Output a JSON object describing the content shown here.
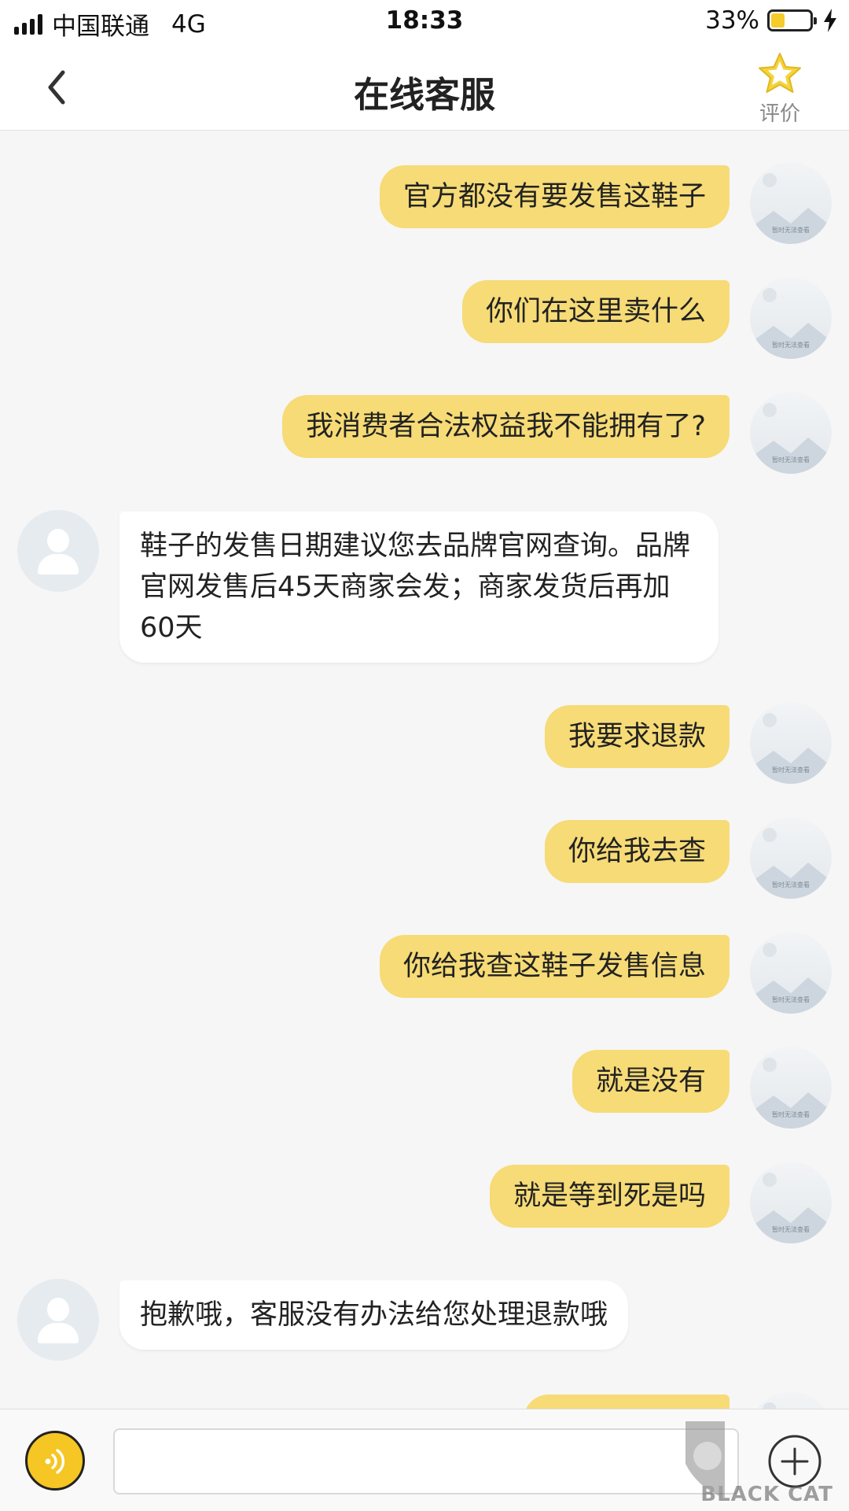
{
  "status_bar": {
    "carrier": "中国联通",
    "network": "4G",
    "time": "18:33",
    "battery_text": "33%",
    "battery_level": 0.33
  },
  "nav": {
    "title": "在线客服",
    "rate_label": "评价"
  },
  "avatar_placeholder_text": "暂时无法查看",
  "messages": [
    {
      "from": "me",
      "text": "官方都没有要发售这鞋子"
    },
    {
      "from": "me",
      "text": "你们在这里卖什么"
    },
    {
      "from": "me",
      "text": "我消费者合法权益我不能拥有了?"
    },
    {
      "from": "agent",
      "text": "鞋子的发售日期建议您去品牌官网查询。品牌官网发售后45天商家会发；商家发货后再加60天"
    },
    {
      "from": "me",
      "text": "我要求退款"
    },
    {
      "from": "me",
      "text": "你给我去查"
    },
    {
      "from": "me",
      "text": "你给我查这鞋子发售信息"
    },
    {
      "from": "me",
      "text": "就是没有"
    },
    {
      "from": "me",
      "text": "就是等到死是吗"
    },
    {
      "from": "agent",
      "text": "抱歉哦，客服没有办法给您处理退款哦"
    }
  ],
  "input": {
    "value": "",
    "placeholder": ""
  },
  "watermark": {
    "text": "BLACK CAT"
  },
  "colors": {
    "bubble_me": "#f6db76",
    "accent": "#f5c624",
    "background": "#f6f6f6"
  }
}
